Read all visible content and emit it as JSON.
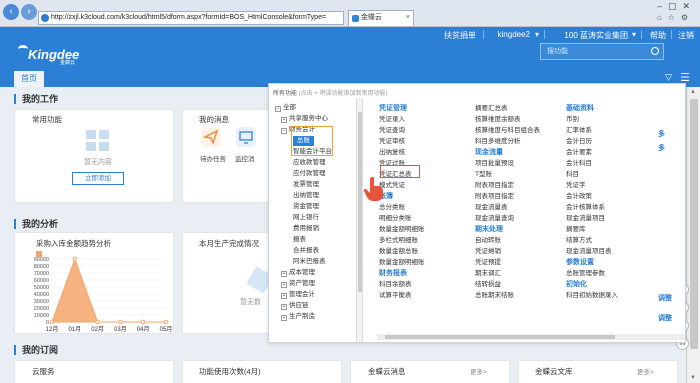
{
  "browser": {
    "url": "http://zxjl.k3cloud.com/k3cloud/html5/dform.aspx?formId=BOS_HtmlConsole&formType=",
    "tab_title": "金蝶云"
  },
  "header": {
    "logo_text": "Kingdee",
    "logo_sub": "金蝶云",
    "links": [
      "扶贫捐单",
      "kingdee2",
      "100 蓝涛实业集团",
      "帮助",
      "注销"
    ],
    "search_placeholder": "搜功能",
    "home_tab": "首页"
  },
  "sections": {
    "work_title": "我的工作",
    "analysis_title": "我的分析",
    "subscribe_title": "我的订阅"
  },
  "common_functions": {
    "title": "常用功能",
    "empty_text": "暂无内容",
    "add_button": "立即添加"
  },
  "messages": {
    "title": "我的消息",
    "items": [
      {
        "label": "待办任务",
        "icon": "paper-plane-icon",
        "color": "#f08a3c"
      },
      {
        "label": "监控消",
        "icon": "monitor-icon",
        "color": "#4a90d9"
      }
    ]
  },
  "analysis": {
    "card2_title": "本月生产完成情况",
    "card2_empty": "暂无数"
  },
  "chart_data": {
    "type": "area",
    "title": "采购入库金额趋势分析",
    "categories": [
      "12月",
      "01月",
      "02月",
      "03月",
      "04月",
      "05月"
    ],
    "values": [
      0,
      90000,
      0,
      0,
      0,
      0
    ],
    "y_ticks": [
      "90000",
      "80000",
      "70000",
      "60000",
      "50000",
      "40000",
      "30000",
      "20000",
      "10000",
      "0"
    ],
    "ylim": [
      0,
      90000
    ],
    "color": "#f4a46a",
    "grid": true,
    "legend": "top-left"
  },
  "subscribe": {
    "cards": [
      {
        "title": "云服务",
        "more": ""
      },
      {
        "title": "功能使用次数(4月)",
        "more": ""
      },
      {
        "title": "金蝶云消息",
        "more": "更多>"
      },
      {
        "title": "金蝶云文库",
        "more": "更多>"
      }
    ]
  },
  "popup": {
    "header": "所有功能",
    "hint": "(点击 + 将该功能添加到常用功能)",
    "tree": [
      {
        "label": "全部",
        "box": "−"
      },
      {
        "label": "共享服务中心",
        "box": "+"
      },
      {
        "label": "财务会计",
        "box": "−"
      },
      {
        "label": "总账",
        "box": ""
      },
      {
        "label": "智能会计平台",
        "box": ""
      },
      {
        "label": "应收款管理",
        "box": ""
      },
      {
        "label": "应付款管理",
        "box": ""
      },
      {
        "label": "发票管理",
        "box": ""
      },
      {
        "label": "出纳管理",
        "box": ""
      },
      {
        "label": "资金管理",
        "box": ""
      },
      {
        "label": "网上银行",
        "box": ""
      },
      {
        "label": "费用报销",
        "box": ""
      },
      {
        "label": "报表",
        "box": ""
      },
      {
        "label": "合并报表",
        "box": ""
      },
      {
        "label": "阿米巴报表",
        "box": ""
      },
      {
        "label": "成本管理",
        "box": "+"
      },
      {
        "label": "资产管理",
        "box": "+"
      },
      {
        "label": "管理会计",
        "box": "+"
      },
      {
        "label": "供应链",
        "box": "+"
      },
      {
        "label": "生产制造",
        "box": "+"
      }
    ],
    "col1": [
      {
        "head": "凭证管理",
        "items": [
          "凭证录入",
          "凭证查询",
          "凭证审核",
          "出纳复核",
          "凭证过账",
          "凭证汇总表",
          "模式凭证"
        ]
      },
      {
        "head": "账簿",
        "items": [
          "总分类账",
          "明细分类账",
          "数量金额明细账",
          "多栏式明细账",
          "数量金额总账",
          "数量金额明细账"
        ]
      },
      {
        "head": "财务报表",
        "items": [
          "科目余额表",
          "试算平衡表"
        ]
      }
    ],
    "col2": [
      {
        "head": "",
        "items": [
          "摘要汇总表",
          "核算维度余额表",
          "核算维度与科目组合表",
          "科目多维度分析"
        ]
      },
      {
        "head": "现金流量",
        "items": [
          "项目批量预设",
          "T型账",
          "附表项目指定",
          "附表项目指定",
          "现金流量表",
          "现金流量查询"
        ]
      },
      {
        "head": "期末处理",
        "items": [
          "自动转账",
          "凭证摊销",
          "凭证预提",
          "期末调汇",
          "结转损益",
          "总账期末结账"
        ]
      }
    ],
    "col3": [
      {
        "head": "基础资料",
        "items": [
          "币别",
          "汇率体系",
          "会计日历",
          "会计要素",
          "会计科目",
          "科目",
          "凭证字",
          "会计政策",
          "会计核算体系",
          "现金流量项目",
          "摘要库",
          "结算方式",
          "现金流量项目表"
        ]
      },
      {
        "head": "参数设置",
        "items": [
          "总账管理参数"
        ]
      },
      {
        "head": "初始化",
        "items": [
          "科目初始数据录入"
        ]
      }
    ],
    "col4": [
      {
        "head": "多",
        "items": []
      },
      {
        "head": "多",
        "items": []
      },
      {
        "head": "调整",
        "items": []
      },
      {
        "head": "调整",
        "items": []
      }
    ]
  }
}
